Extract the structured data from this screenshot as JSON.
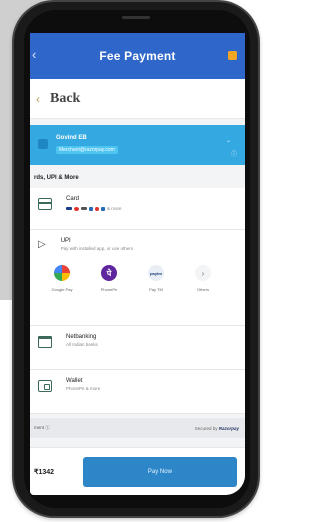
{
  "header": {
    "title": "Fee Payment"
  },
  "back_row": {
    "label": "Back"
  },
  "merchant": {
    "name": "Govind EB",
    "subtitle": "Merchant@razorpay.com"
  },
  "section_title": "rds, UPI & More",
  "options": {
    "card": {
      "title": "Card",
      "sub": "& more"
    },
    "upi": {
      "title": "UPI",
      "sub": "Pay with installed app, or use others",
      "apps": [
        {
          "label": "Google Pay",
          "color": "#f4b400",
          "glyph": "G"
        },
        {
          "label": "PhonePe",
          "color": "#5f259f",
          "glyph": "पे"
        },
        {
          "label": "Pay TM",
          "color": "#e9eef5",
          "glyph": "paytm"
        },
        {
          "label": "Others",
          "color": "#e9eef5",
          "glyph": "›"
        }
      ]
    },
    "netbanking": {
      "title": "Netbanking",
      "sub": "All Indian banks"
    },
    "wallet": {
      "title": "Wallet",
      "sub": "PhonePe & more"
    }
  },
  "footer": {
    "left": "ment ⓘ",
    "right_prefix": "Secured by",
    "right_brand": "Razorpay"
  },
  "pay_bar": {
    "amount": "₹1342",
    "button": "Pay Now"
  },
  "colors": {
    "header": "#2f66c9",
    "merchant": "#34a8e0",
    "pay_button": "#2c86c8"
  }
}
